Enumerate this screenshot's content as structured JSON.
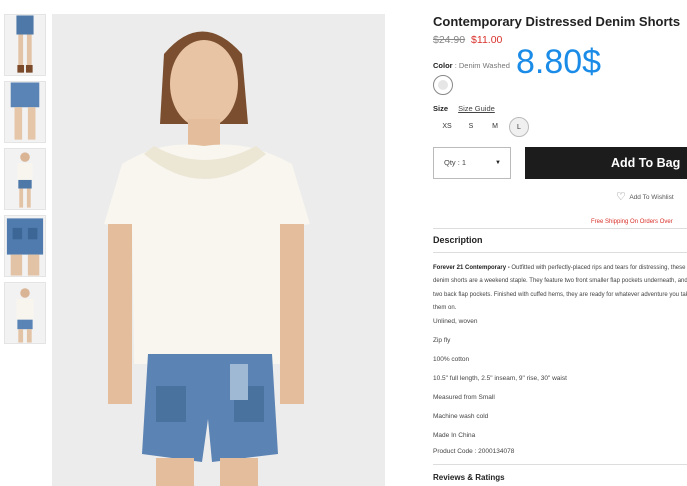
{
  "gallery": {
    "thumbnails": [
      "thumb-shorts-front",
      "thumb-shorts-back",
      "thumb-outfit",
      "thumb-shorts-detail",
      "thumb-shorts-flat"
    ],
    "main_image": "model-white-top-denim-shorts"
  },
  "product": {
    "title": "Contemporary Distressed Denim Shorts",
    "old_price": "$24.90",
    "new_price": "$11.00",
    "overlay_price": "8.80$"
  },
  "color": {
    "label": "Color",
    "separator": ":",
    "value": "Denim Washed"
  },
  "size": {
    "label": "Size",
    "guide": "Size Guide",
    "options": [
      "XS",
      "S",
      "M",
      "L"
    ],
    "selected": "L"
  },
  "qty": {
    "text": "Qty : 1",
    "caret": "▼"
  },
  "actions": {
    "add_to_bag": "Add To Bag",
    "wishlist": "Add To Wishlist",
    "heart": "♡",
    "free_shipping": "Free Shipping On Orders Over"
  },
  "description": {
    "heading": "Description",
    "lead": "Forever 21 Contemporary -",
    "paragraph": " Outfitted with perfectly-placed rips and tears for distressing, these denim shorts are a weekend staple. They feature two front smaller flap pockets underneath, and two back flap pockets. Finished with cuffed hems, they are ready for whatever adventure you take them on.",
    "lines": [
      "Unlined, woven",
      "Zip fly",
      "100% cotton",
      "10.5\" full length, 2.5\" inseam, 9\" rise, 30\" waist",
      "Measured from Small",
      "Machine wash cold",
      "Made In China",
      "Product Code : 2000134078"
    ]
  },
  "reviews": {
    "heading": "Reviews & Ratings"
  },
  "colors": {
    "accent_price": "#d9312b",
    "overlay_blue": "#1a8ce8",
    "button_bg": "#1c1c1c"
  }
}
